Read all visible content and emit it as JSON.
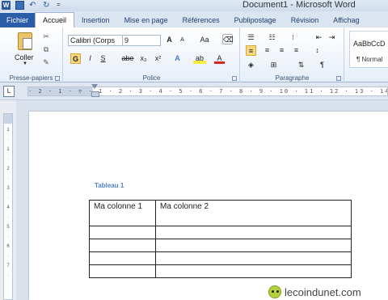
{
  "window": {
    "title": "Document1 - Microsoft Word",
    "qat_word": "W",
    "qat_more": "="
  },
  "tabs": [
    "Fichier",
    "Accueil",
    "Insertion",
    "Mise en page",
    "Références",
    "Publipostage",
    "Révision",
    "Affichag"
  ],
  "ribbon": {
    "clipboard": {
      "paste_label": "Coller",
      "group_label": "Presse-papiers"
    },
    "font": {
      "font_name": "Calibri (Corps",
      "font_size": "9",
      "grow": "A",
      "shrink": "A",
      "case": "Aa",
      "bold": "G",
      "italic": "I",
      "underline": "S",
      "strike": "abe",
      "subscript": "x₂",
      "superscript": "x²",
      "effects": "A",
      "highlight": "ab",
      "color": "A",
      "group_label": "Police"
    },
    "paragraph": {
      "pilcrow": "¶",
      "group_label": "Paragraphe"
    },
    "styles": {
      "sample": "AaBbCcD",
      "normal": "¶ Normal"
    }
  },
  "ruler": {
    "corner": "L",
    "ticks": "· 2 · 1 · ▽ · 1 · 2 · 3 · 4 · 5 · 6 · 7 · 8 · 9 · 10 · 11 · 12 · 13 · 14"
  },
  "vruler": {
    "ticks": [
      "1",
      "·",
      "1",
      "·",
      "2",
      "·",
      "3",
      "·",
      "4",
      "·",
      "5",
      "·",
      "6",
      "·",
      "7",
      "·"
    ]
  },
  "document": {
    "caption": "Tableau 1",
    "table": {
      "header": [
        "Ma colonne 1",
        "Ma colonne 2"
      ],
      "empty_rows": 4
    }
  },
  "watermark": {
    "text": "lecoindunet.com"
  }
}
